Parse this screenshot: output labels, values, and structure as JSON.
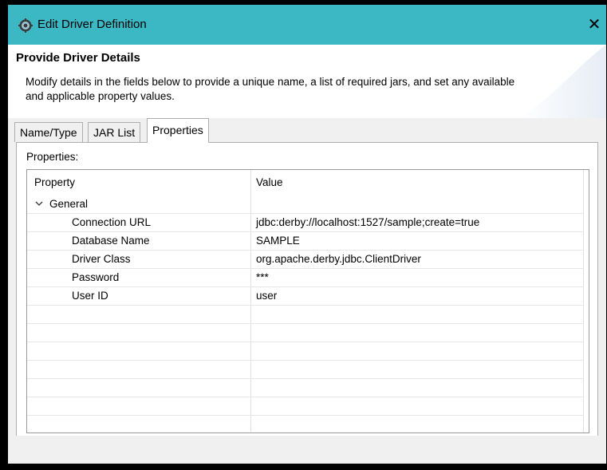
{
  "window": {
    "title": "Edit Driver Definition",
    "close_glyph": "✕",
    "icon": "gear-icon"
  },
  "header": {
    "title": "Provide Driver Details",
    "description": "Modify details in the fields below to provide a unique name, a list of required jars, and set any available and applicable property values."
  },
  "tabs": [
    {
      "label": "Name/Type",
      "active": false
    },
    {
      "label": "JAR List",
      "active": false
    },
    {
      "label": "Properties",
      "active": true
    }
  ],
  "properties": {
    "label": "Properties:",
    "columns": [
      "Property",
      "Value"
    ],
    "group": {
      "name": "General",
      "expanded": true
    },
    "rows": [
      {
        "property": "Connection URL",
        "value": "jdbc:derby://localhost:1527/sample;create=true"
      },
      {
        "property": "Database Name",
        "value": "SAMPLE"
      },
      {
        "property": "Driver Class",
        "value": "org.apache.derby.jdbc.ClientDriver"
      },
      {
        "property": "Password",
        "value": "***"
      },
      {
        "property": "User ID",
        "value": "user"
      }
    ]
  },
  "colors": {
    "titlebar": "#3cb8c4",
    "panel_bg": "#f0f0f0",
    "border": "#adadad"
  }
}
